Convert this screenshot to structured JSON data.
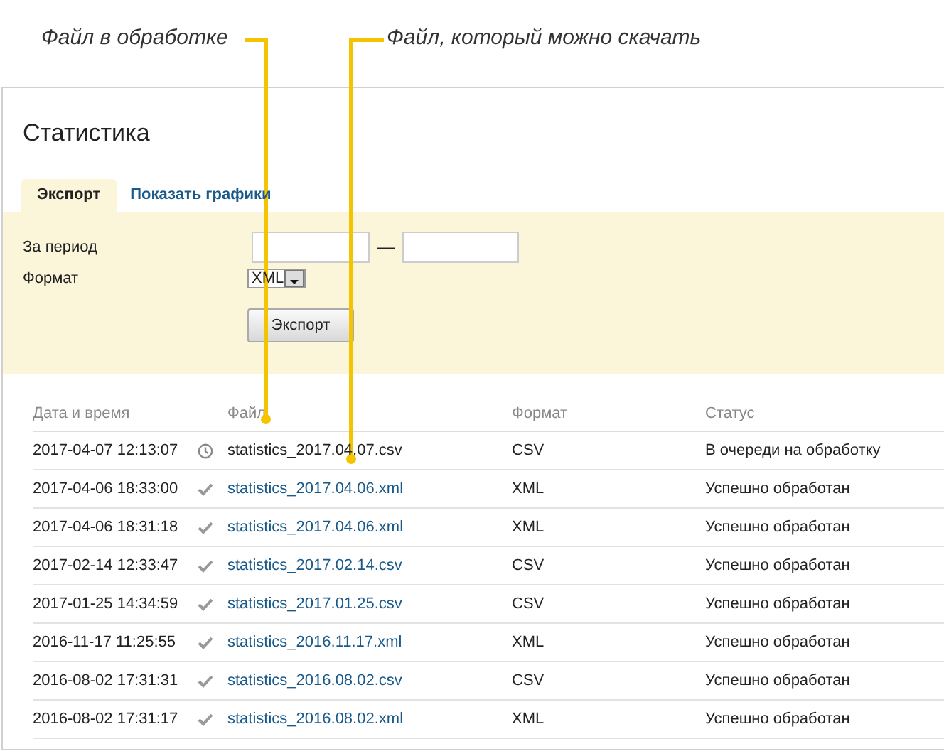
{
  "annotations": [
    {
      "text": "Файл в обработке"
    },
    {
      "text": "Файл, который можно скачать"
    }
  ],
  "title": "Статистика",
  "tabs": [
    {
      "label": "Экспорт",
      "selected": true
    },
    {
      "label": "Показать графики",
      "selected": false
    }
  ],
  "form": {
    "period_label": "За период",
    "dash": "—",
    "format_label": "Формат",
    "format_value": "XML",
    "button": "Экспорт"
  },
  "table": {
    "columns": [
      "Дата и время",
      "Файл",
      "Формат",
      "Статус"
    ],
    "rows": [
      {
        "date": "2017-04-07 12:13:07",
        "kind": "queued",
        "file": "statistics_2017.04.07.csv",
        "format": "CSV",
        "status": "В очереди на обработку"
      },
      {
        "date": "2017-04-06 18:33:00",
        "kind": "done",
        "file": "statistics_2017.04.06.xml",
        "format": "XML",
        "status": "Успешно обработан"
      },
      {
        "date": "2017-04-06 18:31:18",
        "kind": "done",
        "file": "statistics_2017.04.06.xml",
        "format": "XML",
        "status": "Успешно обработан"
      },
      {
        "date": "2017-02-14 12:33:47",
        "kind": "done",
        "file": "statistics_2017.02.14.csv",
        "format": "CSV",
        "status": "Успешно обработан"
      },
      {
        "date": "2017-01-25 14:34:59",
        "kind": "done",
        "file": "statistics_2017.01.25.csv",
        "format": "CSV",
        "status": "Успешно обработан"
      },
      {
        "date": "2016-11-17 11:25:55",
        "kind": "done",
        "file": "statistics_2016.11.17.xml",
        "format": "XML",
        "status": "Успешно обработан"
      },
      {
        "date": "2016-08-02 17:31:31",
        "kind": "done",
        "file": "statistics_2016.08.02.csv",
        "format": "CSV",
        "status": "Успешно обработан"
      },
      {
        "date": "2016-08-02 17:31:17",
        "kind": "done",
        "file": "statistics_2016.08.02.xml",
        "format": "XML",
        "status": "Успешно обработан"
      }
    ]
  }
}
